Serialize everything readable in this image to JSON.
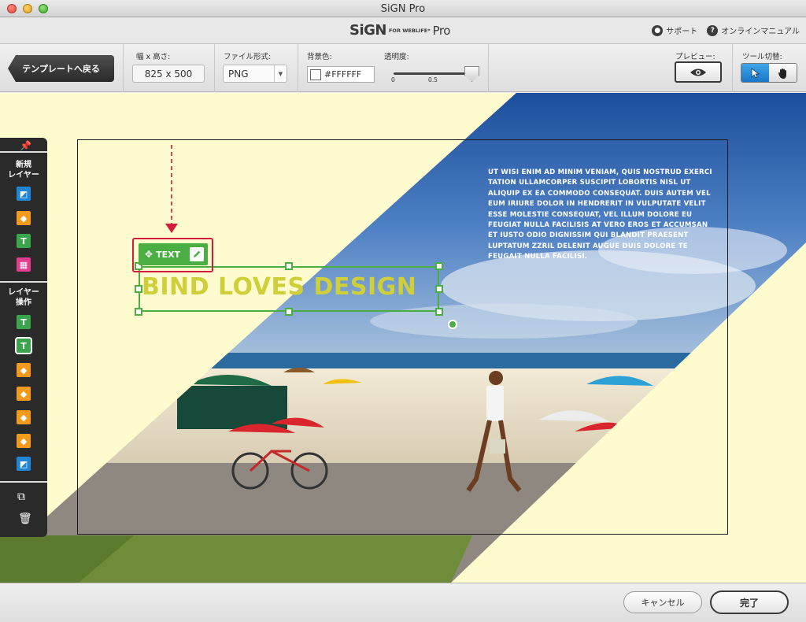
{
  "window": {
    "title": "SiGN Pro"
  },
  "brand": {
    "name": "SiGN",
    "sub": "FOR WEBLIFE*",
    "suffix": "Pro"
  },
  "header_links": {
    "support": "サポート",
    "manual": "オンラインマニュアル"
  },
  "toolbar": {
    "back_label": "テンプレートへ戻る",
    "size_label": "幅 x 高さ:",
    "size_value": "825 x 500",
    "format_label": "ファイル形式:",
    "format_value": "PNG",
    "bg_label": "背景色:",
    "bg_value": "#FFFFFF",
    "opacity_label": "透明度:",
    "opacity_min": "0",
    "opacity_mid": "0.5",
    "opacity_value": 0.9,
    "preview_label": "プレビュー:",
    "tool_label": "ツール切替:"
  },
  "canvas": {
    "body_text": "UT WISI ENIM AD MINIM VENIAM, QUIS NOSTRUD EXERCI TATION ULLAMCORPER SUSCIPIT LOBORTIS NISL UT ALIQUIP EX EA COMMODO CONSEQUAT. DUIS AUTEM VEL EUM IRIURE DOLOR IN HENDRERIT IN VULPUTATE VELIT ESSE MOLESTIE CONSEQUAT, VEL ILLUM DOLORE EU FEUGIAT NULLA FACILISIS AT VERO EROS ET ACCUMSAN ET IUSTO ODIO DIGNISSIM QUI BLANDIT PRAESENT LUPTATUM ZZRIL DELENIT AUGUE DUIS DOLORE TE FEUGAIT NULLA FACILISI.",
    "headline": "BIND LOVES DESIGN",
    "text_tag": "TEXT"
  },
  "side_panel": {
    "new_layer_label": "新規\nレイヤー",
    "layer_ops_label": "レイヤー\n操作",
    "text_glyph": "T"
  },
  "footer": {
    "cancel_label": "キャンセル",
    "done_label": "完了"
  },
  "colors": {
    "accent_green": "#4bae43",
    "highlight_red": "#d21c3d",
    "headline_yellow": "#cfcf3a",
    "canvas_bg": "#fefbcf"
  }
}
